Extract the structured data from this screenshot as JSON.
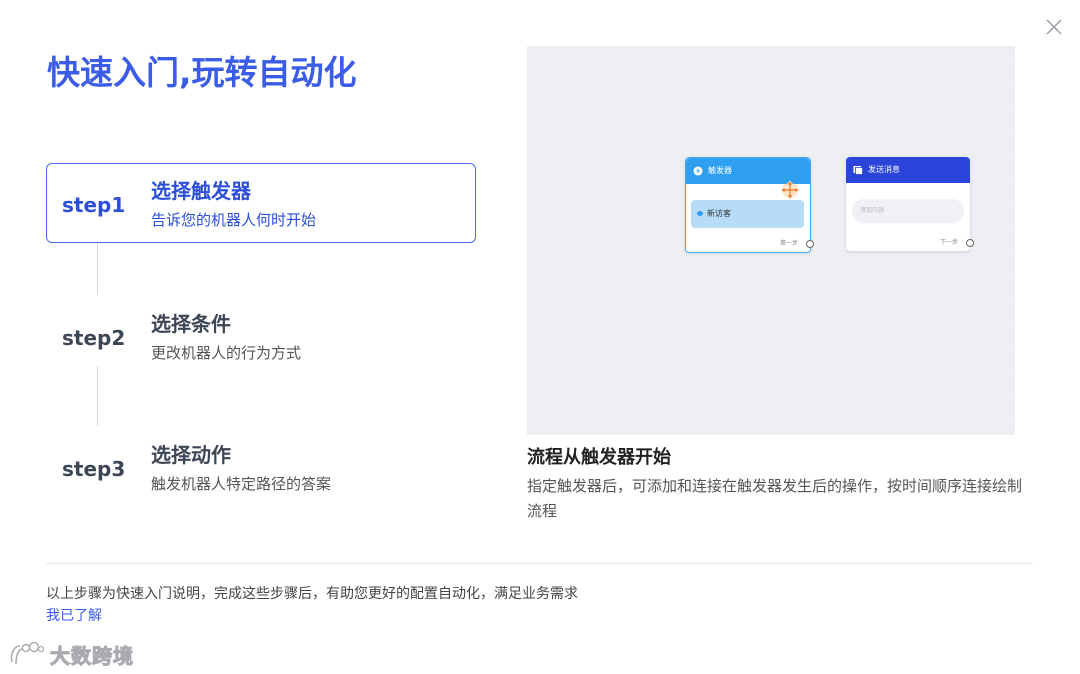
{
  "title": "快速入门,玩转自动化",
  "steps": [
    {
      "num": "step1",
      "title": "选择触发器",
      "desc": "告诉您的机器人何时开始",
      "active": true
    },
    {
      "num": "step2",
      "title": "选择条件",
      "desc": "更改机器人的行为方式",
      "active": false
    },
    {
      "num": "step3",
      "title": "选择动作",
      "desc": "触发机器人特定路径的答案",
      "active": false
    }
  ],
  "preview": {
    "trigger_node": {
      "title": "触发器",
      "item": "新访客",
      "footer": "第一步"
    },
    "message_node": {
      "title": "发送消息",
      "placeholder": "添加内容",
      "footer": "下一步"
    },
    "caption_title": "流程从触发器开始",
    "caption_desc": "指定触发器后，可添加和连接在触发器发生后的操作，按时间顺序连接绘制流程"
  },
  "footer": {
    "note": "以上步骤为快速入门说明，完成这些步骤后，有助您更好的配置自动化，满足业务需求",
    "link": "我已了解"
  },
  "watermark": {
    "text": "大数跨境"
  },
  "colors": {
    "accent": "#3b5ce6",
    "trigger_head": "#2f9fef",
    "message_head": "#2b44d9"
  }
}
